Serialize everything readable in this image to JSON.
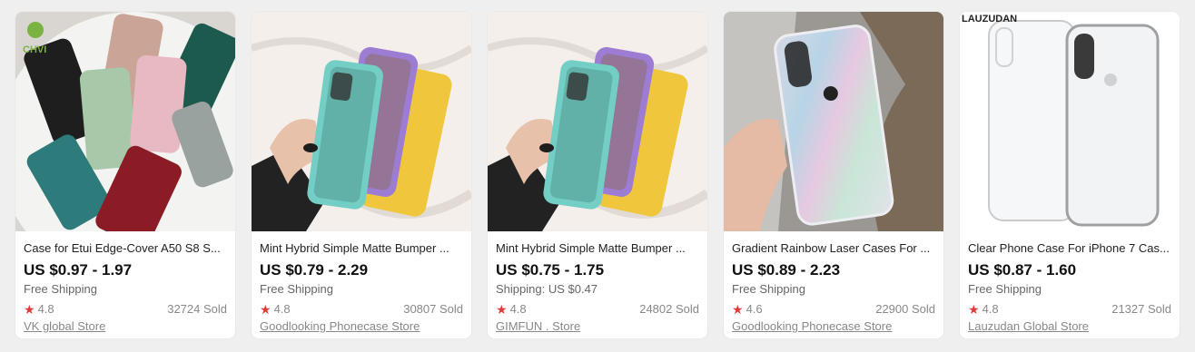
{
  "products": [
    {
      "title": "Case for Etui Edge-Cover A50 S8 S...",
      "price": "US $0.97 - 1.97",
      "shipping": "Free Shipping",
      "rating": "4.8",
      "sold": "32724 Sold",
      "store": "VK global Store",
      "image_label": "colorful silicone phone cases",
      "logo_text": "CHVI"
    },
    {
      "title": "Mint Hybrid Simple Matte Bumper ...",
      "price": "US $0.79 - 2.29",
      "shipping": "Free Shipping",
      "rating": "4.8",
      "sold": "30807 Sold",
      "store": "Goodlooking Phonecase Store",
      "image_label": "hand holding mint purple yellow cases"
    },
    {
      "title": "Mint Hybrid Simple Matte Bumper ...",
      "price": "US $0.75 - 1.75",
      "shipping": "Shipping: US $0.47",
      "rating": "4.8",
      "sold": "24802 Sold",
      "store": "GIMFUN . Store",
      "image_label": "hand holding mint purple yellow cases"
    },
    {
      "title": "Gradient Rainbow Laser Cases For ...",
      "price": "US $0.89 - 2.23",
      "shipping": "Free Shipping",
      "rating": "4.6",
      "sold": "22900 Sold",
      "store": "Goodlooking Phonecase Store",
      "image_label": "hand holding holographic iphone case"
    },
    {
      "title": "Clear Phone Case For iPhone 7 Cas...",
      "price": "US $0.87 - 1.60",
      "shipping": "Free Shipping",
      "rating": "4.8",
      "sold": "21327 Sold",
      "store": "Lauzudan Global Store",
      "image_label": "clear transparent iphone case",
      "brand_text": "LAUZUDAN"
    }
  ],
  "icons": {
    "star": "★"
  },
  "colors": {
    "star": "#e53a3a",
    "background": "#efefef"
  }
}
